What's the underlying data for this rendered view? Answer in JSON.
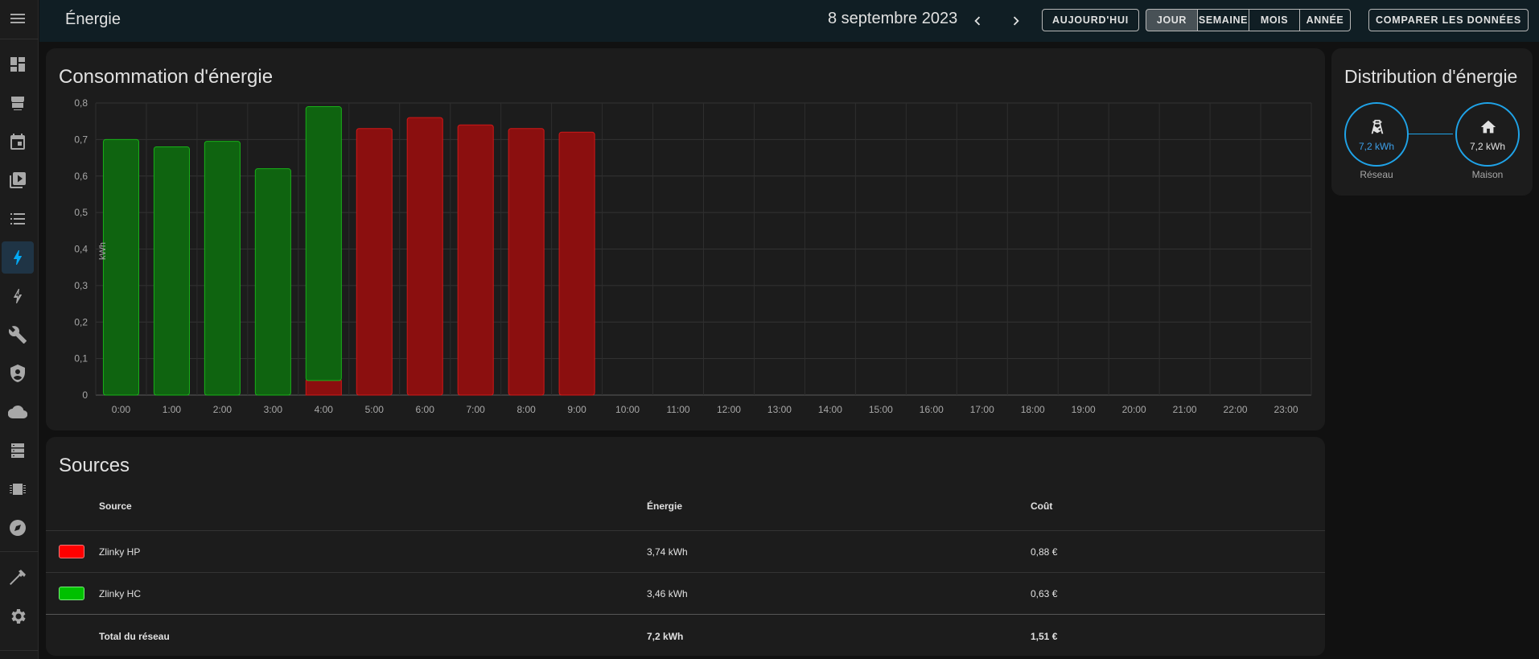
{
  "header": {
    "title": "Énergie",
    "date": "8 septembre 2023",
    "today_label": "AUJOURD'HUI",
    "periods": [
      "JOUR",
      "SEMAINE",
      "MOIS",
      "ANNÉE"
    ],
    "active_period": "JOUR",
    "compare_label": "COMPARER LES DONNÉES"
  },
  "sidebar": {
    "icons": [
      "menu-icon",
      "dashboard-icon",
      "hacs-icon",
      "calendar-icon",
      "media-icon",
      "list-icon",
      "energy-icon",
      "energy-outline-icon",
      "wrench-icon",
      "shield-icon",
      "cloud-icon",
      "server-icon",
      "chip-icon",
      "compass-icon",
      "hammer-icon",
      "gear-icon"
    ],
    "active": "energy-icon"
  },
  "consumption": {
    "title": "Consommation d'énergie",
    "chart_data": {
      "type": "bar",
      "ylabel": "kWh",
      "ylim": [
        0,
        0.8
      ],
      "yticks": [
        "0",
        "0,1",
        "0,2",
        "0,3",
        "0,4",
        "0,5",
        "0,6",
        "0,7",
        "0,8"
      ],
      "categories": [
        "0:00",
        "1:00",
        "2:00",
        "3:00",
        "4:00",
        "5:00",
        "6:00",
        "7:00",
        "8:00",
        "9:00",
        "10:00",
        "11:00",
        "12:00",
        "13:00",
        "14:00",
        "15:00",
        "16:00",
        "17:00",
        "18:00",
        "19:00",
        "20:00",
        "21:00",
        "22:00",
        "23:00"
      ],
      "stacked": true,
      "series": [
        {
          "name": "Zlinky HP",
          "color": "#8b0f0f",
          "stroke": "#d01818",
          "values": [
            0,
            0,
            0,
            0,
            0.04,
            0.73,
            0.76,
            0.74,
            0.73,
            0.72,
            null,
            null,
            null,
            null,
            null,
            null,
            null,
            null,
            null,
            null,
            null,
            null,
            null,
            null
          ]
        },
        {
          "name": "Zlinky HC",
          "color": "#0f6410",
          "stroke": "#18b018",
          "values": [
            0.7,
            0.68,
            0.695,
            0.62,
            0.75,
            0,
            0,
            0,
            0,
            0,
            null,
            null,
            null,
            null,
            null,
            null,
            null,
            null,
            null,
            null,
            null,
            null,
            null,
            null
          ]
        }
      ],
      "grid": true
    }
  },
  "distribution": {
    "title": "Distribution d'énergie",
    "grid_value": "7,2 kWh",
    "grid_label": "Réseau",
    "home_value": "7,2 kWh",
    "home_label": "Maison"
  },
  "sources": {
    "title": "Sources",
    "headers": {
      "source": "Source",
      "energy": "Énergie",
      "cost": "Coût"
    },
    "rows": [
      {
        "name": "Zlinky HP",
        "energy": "3,74 kWh",
        "cost": "0,88 €",
        "color": "#ff0000"
      },
      {
        "name": "Zlinky HC",
        "energy": "3,46 kWh",
        "cost": "0,63 €",
        "color": "#00c000"
      }
    ],
    "total": {
      "name": "Total du réseau",
      "energy": "7,2 kWh",
      "cost": "1,51 €"
    }
  }
}
